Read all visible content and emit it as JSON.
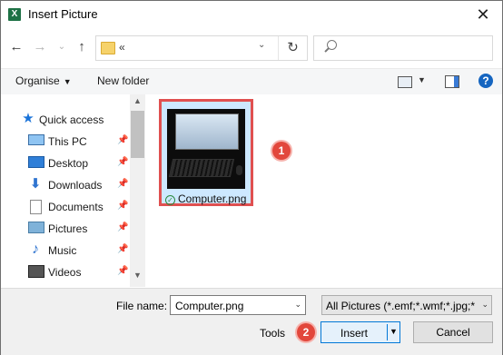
{
  "window": {
    "title": "Insert Picture",
    "app_icon_letter": "X"
  },
  "address": {
    "path": "«",
    "search_placeholder": ""
  },
  "toolbar": {
    "organise_label": "Organise",
    "new_folder_label": "New folder",
    "help_symbol": "?"
  },
  "sidebar": {
    "items": [
      {
        "label": "Quick access",
        "icon": "star-icon",
        "pinned": false
      },
      {
        "label": "This PC",
        "icon": "computer-icon",
        "pinned": true
      },
      {
        "label": "Desktop",
        "icon": "desktop-icon",
        "pinned": true
      },
      {
        "label": "Downloads",
        "icon": "download-icon",
        "pinned": true
      },
      {
        "label": "Documents",
        "icon": "document-icon",
        "pinned": true
      },
      {
        "label": "Pictures",
        "icon": "pictures-icon",
        "pinned": true
      },
      {
        "label": "Music",
        "icon": "music-icon",
        "pinned": true
      },
      {
        "label": "Videos",
        "icon": "video-icon",
        "pinned": true
      }
    ]
  },
  "files": [
    {
      "name": "Computer.png",
      "selected": true,
      "sync_status": "available"
    }
  ],
  "annotations": {
    "step1": "1",
    "step2": "2",
    "color": "#e2473c"
  },
  "footer": {
    "file_name_label": "File name:",
    "file_name_value": "Computer.png",
    "file_type_value": "All Pictures (*.emf;*.wmf;*.jpg;*",
    "tools_label": "Tools",
    "insert_label": "Insert",
    "cancel_label": "Cancel"
  },
  "colors": {
    "selection": "#cde8ff",
    "highlight_border": "#e05050",
    "primary_button_border": "#0078d7"
  }
}
